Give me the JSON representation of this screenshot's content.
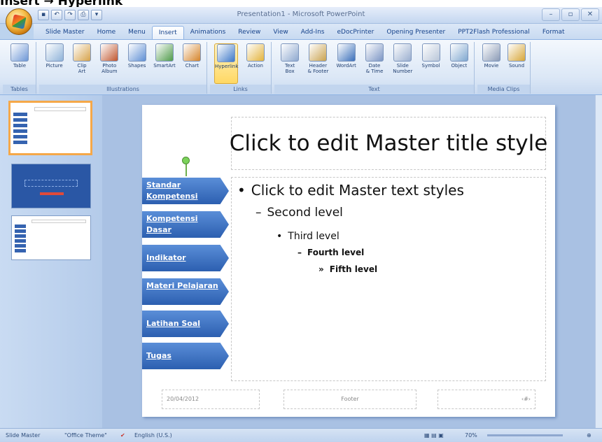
{
  "caption": "Insert → Hyperlink",
  "app_title": "Presentation1 - Microsoft PowerPoint",
  "qat_icons": [
    "save-icon",
    "undo-icon",
    "redo-icon",
    "print-icon",
    "customize-icon"
  ],
  "tabs": [
    "Slide Master",
    "Home",
    "Menu",
    "Insert",
    "Animations",
    "Review",
    "View",
    "Add-Ins",
    "eDocPrinter",
    "Opening Presenter",
    "PPT2Flash Professional",
    "Format"
  ],
  "active_tab": "Insert",
  "ribbon": {
    "groups": [
      {
        "label": "Tables",
        "buttons": [
          {
            "label": "Table",
            "icon": "table-icon"
          }
        ]
      },
      {
        "label": "Illustrations",
        "buttons": [
          {
            "label": "Picture",
            "icon": "picture-icon"
          },
          {
            "label": "Clip\nArt",
            "icon": "clip-art-icon"
          },
          {
            "label": "Photo\nAlbum",
            "icon": "photo-album-icon"
          },
          {
            "label": "Shapes",
            "icon": "shapes-icon"
          },
          {
            "label": "SmartArt",
            "icon": "smartart-icon"
          },
          {
            "label": "Chart",
            "icon": "chart-icon"
          }
        ]
      },
      {
        "label": "Links",
        "buttons": [
          {
            "label": "Hyperlink",
            "icon": "hyperlink-icon"
          },
          {
            "label": "Action",
            "icon": "action-icon"
          }
        ]
      },
      {
        "label": "Text",
        "buttons": [
          {
            "label": "Text\nBox",
            "icon": "text-box-icon"
          },
          {
            "label": "Header\n& Footer",
            "icon": "header-footer-icon"
          },
          {
            "label": "WordArt",
            "icon": "wordart-icon"
          },
          {
            "label": "Date\n& Time",
            "icon": "date-time-icon"
          },
          {
            "label": "Slide\nNumber",
            "icon": "slide-number-icon"
          },
          {
            "label": "Symbol",
            "icon": "symbol-icon"
          },
          {
            "label": "Object",
            "icon": "object-icon"
          }
        ]
      },
      {
        "label": "Media Clips",
        "buttons": [
          {
            "label": "Movie",
            "icon": "movie-icon"
          },
          {
            "label": "Sound",
            "icon": "sound-icon"
          }
        ]
      }
    ]
  },
  "slide": {
    "title": "Click to edit Master title style",
    "levels": [
      {
        "bullet": "•",
        "text": "Click to edit Master text styles"
      },
      {
        "bullet": "–",
        "text": "Second level"
      },
      {
        "bullet": "•",
        "text": "Third level"
      },
      {
        "bullet": "–",
        "text": "Fourth level"
      },
      {
        "bullet": "»",
        "text": "Fifth level"
      }
    ],
    "menu": [
      "Standar Kompetensi",
      "Kompetensi Dasar",
      "Indikator",
      "Materi Pelajaran",
      "Latihan Soal",
      "Tugas"
    ],
    "footer": {
      "date": "20/04/2012",
      "center": "Footer",
      "number": "‹#›"
    }
  },
  "status": {
    "view": "Slide Master",
    "theme": "\"Office Theme\"",
    "language": "English (U.S.)",
    "zoom": "70%"
  },
  "colors": {
    "active_thumb_border": "#f5a849",
    "menu_blue": "#2c5fb0",
    "ribbon_bg": "#dbe7f6"
  }
}
